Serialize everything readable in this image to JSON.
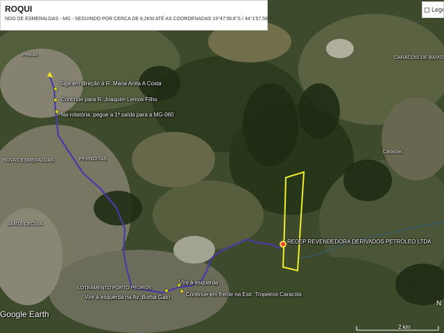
{
  "header": {
    "title": "ROQUI",
    "subtitle": "NDO DE ESMERALDAS - MG - SEGUINDO POR CERCA DE 8,2KM ATÉ AS COORDENADAS 19°47'39.8\"S / 44°1'57.58\"O"
  },
  "legend": {
    "label": "Legen"
  },
  "route_steps": [
    "Siga em direção à R. Maria Anita A Costa",
    "Continue para R. Joaquim Lemos Filho",
    "Na rotatória, pegue a 1ª saída para a MG-060",
    "Vire à esquerda na Av. Borba Gato",
    "Vire à esquerda",
    "Continue em frente na Estr. Tropeiros Caracóis"
  ],
  "destination": {
    "name": "REDEP REVENDEDORA DERIVADOS PETROLEO LTDA"
  },
  "places": [
    "Pedras",
    "NOVAS ESMERALDAS",
    "PERNOITAS",
    "SANTA CECÍLIA",
    "LOTEAMENTO PORTO PEDROS",
    "CARACÓIS DE BAIXO",
    "Caracóis"
  ],
  "watermark": "Google Earth",
  "scale": {
    "label": "2 km"
  },
  "compass": "N",
  "colors": {
    "route": "#4a3aa8",
    "area_outline": "#f2f22a",
    "start_marker": "#e8e020",
    "waypoint": "#d6d21a"
  }
}
